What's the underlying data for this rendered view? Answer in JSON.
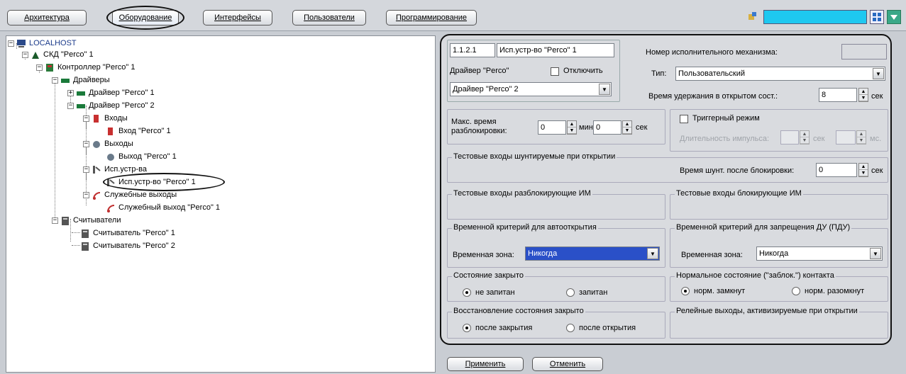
{
  "tabs": [
    {
      "label": "Архитектура"
    },
    {
      "label": "Оборудование"
    },
    {
      "label": "Интерфейсы"
    },
    {
      "label": "Пользователи"
    },
    {
      "label": "Программирование"
    }
  ],
  "tree": {
    "localhost": "LOCALHOST",
    "skd": "СКД \"Perco\" 1",
    "controller": "Контроллер \"Perco\" 1",
    "drivers": "Драйверы",
    "driver1": "Драйвер \"Perco\" 1",
    "driver2": "Драйвер \"Perco\" 2",
    "inputs": "Входы",
    "input1": "Вход \"Perco\" 1",
    "outputs": "Выходы",
    "output1": "Выход \"Perco\" 1",
    "actuators": "Исп.устр-ва",
    "actuator1": "Исп.устр-во \"Perco\" 1",
    "service_outputs": "Служебные выходы",
    "service_output1": "Служебный выход \"Perco\" 1",
    "readers": "Считыватели",
    "reader1": "Считыватель \"Perco\" 1",
    "reader2": "Считыватель \"Perco\" 2"
  },
  "panel": {
    "id": "1.1.2.1",
    "name": "Исп.устр-во \"Perco\" 1",
    "driver_label": "Драйвер \"Perco\"",
    "disable_label": "Отключить",
    "driver_value": "Драйвер \"Perco\" 2",
    "mech_number_label": "Номер исполнительного механизма:",
    "type_label": "Тип:",
    "type_value": "Пользовательский",
    "hold_label": "Время удержания в открытом сост.:",
    "hold_value": "8",
    "sec": "сек",
    "min": "мин",
    "ms": "мс.",
    "max_unlock_label": "Макс. время разблокировки:",
    "max_min": "0",
    "max_sec": "0",
    "trigger_label": "Триггерный режим",
    "pulse_label": "Длительность импульса:",
    "test_shunt_title": "Тестовые входы шунтируемые при открытии",
    "shunt_time_label": "Время шунт. после блокировки:",
    "shunt_time_value": "0",
    "test_unlock_title": "Тестовые входы разблокирующие ИМ",
    "test_block_title": "Тестовые входы блокирующие ИМ",
    "auto_open_title": "Временной критерий для автооткрытия",
    "zone_label": "Временная зона:",
    "zone_auto_value": "Никогда",
    "forbid_title": "Временной критерий для запрещения ДУ (ПДУ)",
    "zone_forbid_value": "Никогда",
    "closed_state_title": "Состояние закрыто",
    "not_powered": "не запитан",
    "powered": "запитан",
    "normal_state_title": "Нормальное состояние (\"заблок.\") контакта",
    "norm_closed": "норм. замкнут",
    "norm_open": "норм. разомкнут",
    "restore_title": "Восстановление состояния закрыто",
    "after_close": "после закрытия",
    "after_open": "после открытия",
    "relay_title": "Релейные выходы, активизируемые при открытии"
  },
  "buttons": {
    "apply": "Применить",
    "cancel": "Отменить"
  },
  "colors": {
    "accent": "#2a50c8",
    "search": "#1ec8f0"
  }
}
